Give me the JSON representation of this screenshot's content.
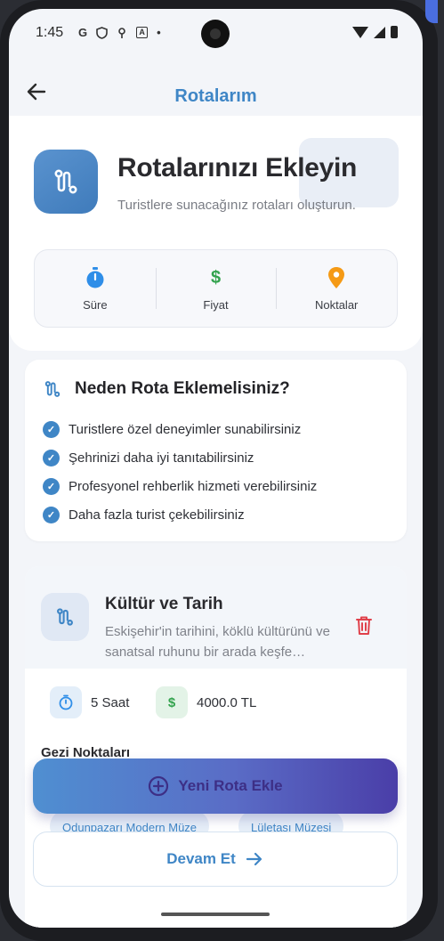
{
  "status_bar": {
    "time": "1:45",
    "icons": [
      "G",
      "shield-icon",
      "location-icon",
      "A",
      "•"
    ]
  },
  "app_bar": {
    "title": "Rotalarım"
  },
  "hero": {
    "title": "Rotalarınızı Ekleyin",
    "subtitle": "Turistlere sunacağınız rotaları oluşturun.",
    "stats": [
      {
        "label": "Süre",
        "icon": "timer-icon",
        "color": "#2f8ee8"
      },
      {
        "label": "Fiyat",
        "icon": "dollar-icon",
        "color": "#33a34e"
      },
      {
        "label": "Noktalar",
        "icon": "map-pin-icon",
        "color": "#f59a15"
      }
    ]
  },
  "why": {
    "title": "Neden Rota Eklemelisiniz?",
    "items": [
      "Turistlere özel deneyimler sunabilirsiniz",
      "Şehrinizi daha iyi tanıtabilirsiniz",
      "Profesyonel rehberlik hizmeti verebilirsiniz",
      "Daha fazla turist çekebilirsiniz"
    ]
  },
  "route": {
    "name": "Kültür ve Tarih",
    "description": "Eskişehir'in tarihini, köklü kültürünü ve sanatsal ruhunu bir arada keşfe…",
    "duration": "5 Saat",
    "price": "4000.0 TL",
    "points_title": "Gezi Noktaları",
    "points": [
      "Odunpazarı Modern Müze",
      "Lületaşı Müzesi"
    ]
  },
  "actions": {
    "add_label": "Yeni Rota Ekle",
    "continue_label": "Devam Et"
  },
  "colors": {
    "primary": "#3f86c6",
    "danger": "#e0414b"
  }
}
